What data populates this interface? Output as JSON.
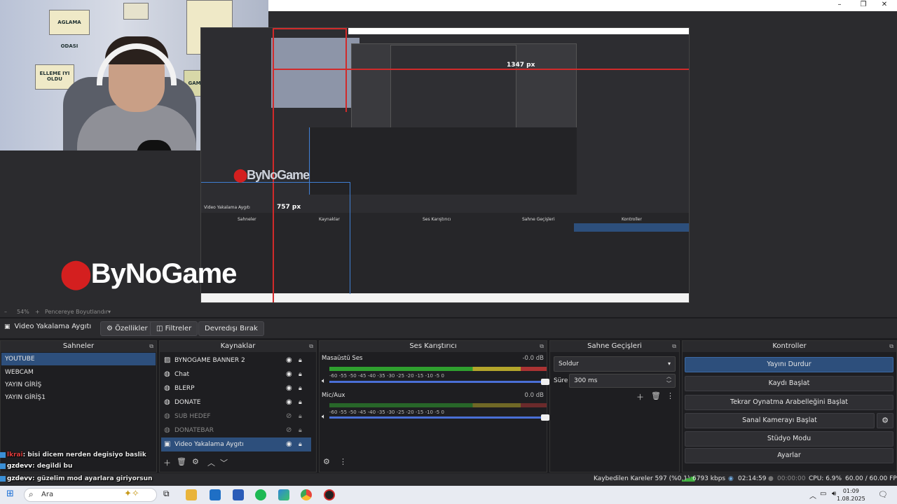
{
  "titlebar": {
    "minimize": "–",
    "restore": "❐",
    "close": "✕"
  },
  "preview": {
    "measure_width": "1347 px",
    "measure_height": "757 px",
    "logo_text": "ByNoGame",
    "webcam_posters": [
      "AGLAMA ODASI",
      "ELLEME IYI OLDU",
      "GAME ZONE"
    ]
  },
  "zoom": {
    "minus": "–",
    "percent": "54%",
    "plus": "+",
    "mode": "Pencereye Boyutlandır",
    "dropdown": "▾"
  },
  "source_toolbar": {
    "current_source": "Video Yakalama Aygıtı",
    "properties": "Özellikler",
    "filters": "Filtreler",
    "deactivate": "Devredışı Bırak"
  },
  "scenes": {
    "title": "Sahneler",
    "items": [
      {
        "label": "YOUTUBE",
        "selected": true
      },
      {
        "label": "WEBCAM",
        "selected": false
      },
      {
        "label": "YAYIN GİRİŞ",
        "selected": false
      },
      {
        "label": "YAYIN GİRİŞ1",
        "selected": false
      }
    ]
  },
  "sources": {
    "title": "Kaynaklar",
    "items": [
      {
        "label": "BYNOGAME BANNER 2",
        "icon": "image-icon",
        "visible": true,
        "dim": false,
        "selected": false
      },
      {
        "label": "Chat",
        "icon": "browser-icon",
        "visible": true,
        "dim": false,
        "selected": false
      },
      {
        "label": "BLERP",
        "icon": "browser-icon",
        "visible": true,
        "dim": false,
        "selected": false
      },
      {
        "label": "DONATE",
        "icon": "browser-icon",
        "visible": true,
        "dim": false,
        "selected": false
      },
      {
        "label": "SUB HEDEF",
        "icon": "browser-icon",
        "visible": false,
        "dim": true,
        "selected": false
      },
      {
        "label": "DONATEBAR",
        "icon": "browser-icon",
        "visible": false,
        "dim": true,
        "selected": false
      },
      {
        "label": "Video Yakalama Aygıtı",
        "icon": "camera-icon",
        "visible": true,
        "dim": false,
        "selected": true
      }
    ]
  },
  "mixer": {
    "title": "Ses Karıştırıcı",
    "channels": [
      {
        "name": "Masaüstü Ses",
        "db": "-0.0 dB"
      },
      {
        "name": "Mic/Aux",
        "db": "0.0 dB"
      }
    ],
    "ticks": "-60   -55   -50   -45   -40   -35   -30   -25   -20   -15   -10   -5    0"
  },
  "transitions": {
    "title": "Sahne Geçişleri",
    "type": "Soldur",
    "duration_label": "Süre",
    "duration_value": "300 ms"
  },
  "controls": {
    "title": "Kontroller",
    "buttons": [
      {
        "label": "Yayını Durdur",
        "active": true
      },
      {
        "label": "Kaydı Başlat",
        "active": false
      },
      {
        "label": "Tekrar Oynatma Arabelleğini Başlat",
        "active": false
      },
      {
        "label": "Sanal Kamerayı Başlat",
        "active": false
      },
      {
        "label": "Stüdyo Modu",
        "active": false
      },
      {
        "label": "Ayarlar",
        "active": false
      }
    ]
  },
  "chat": [
    {
      "user": "lkrai",
      "user_color": "#e03c3c",
      "text": ": bisi dicem nerden degisiyo baslik"
    },
    {
      "user": "gzdevv",
      "user_color": "#ffffff",
      "text": ": degildi bu"
    },
    {
      "user": "gzdevv",
      "user_color": "#ffffff",
      "text": ": güzelim mod ayarlara giriyorsun"
    }
  ],
  "status": {
    "dropped_frames": "Kaybedilen Kareler 597 (%0.1)",
    "bitrate": "6793 kbps",
    "stream_time": "02:14:59",
    "rec_time": "00:00:00",
    "cpu": "CPU: 6.9%",
    "fps": "60.00 / 60.00 FPS"
  },
  "taskbar": {
    "search_placeholder": "Ara",
    "time": "01:09",
    "date": "1.08.2025"
  },
  "colors": {
    "accent": "#2d4f7c",
    "meter_green": "#2fa02f",
    "meter_yellow": "#b3a52b",
    "meter_red": "#aa3333",
    "measure_red": "#d12a2a"
  }
}
